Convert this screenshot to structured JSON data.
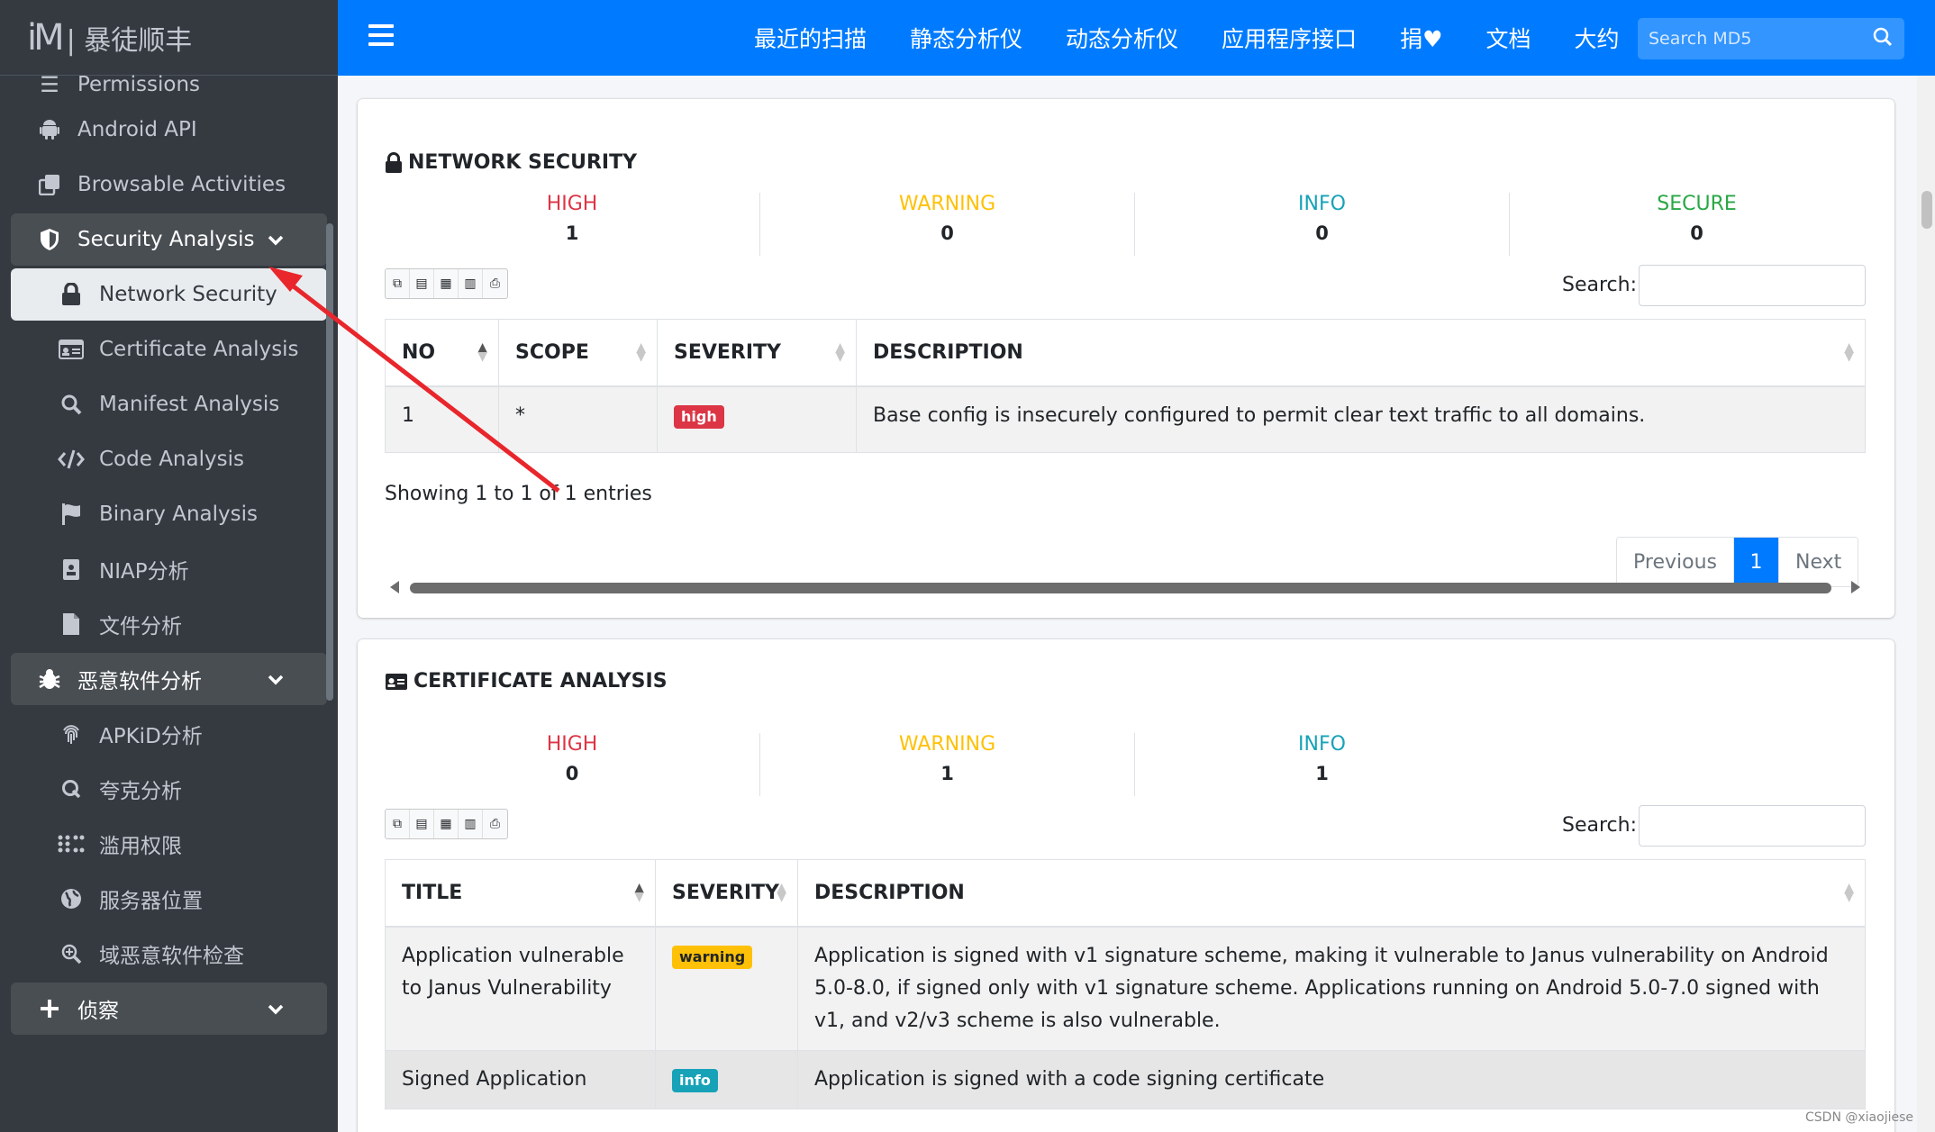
{
  "brand": {
    "logo": "iM",
    "name": "| 暴徒顺丰"
  },
  "sidebar": {
    "partial_label": "Permissions",
    "items": [
      {
        "label": "Android API",
        "icon": "android-icon"
      },
      {
        "label": "Browsable Activities",
        "icon": "clone-icon"
      },
      {
        "label": "Security Analysis",
        "icon": "shield-icon",
        "expanded": true
      },
      {
        "label": "Network Security",
        "icon": "lock-icon",
        "active": true
      },
      {
        "label": "Certificate Analysis",
        "icon": "id-card-icon"
      },
      {
        "label": "Manifest Analysis",
        "icon": "search-icon"
      },
      {
        "label": "Code Analysis",
        "icon": "code-icon"
      },
      {
        "label": "Binary Analysis",
        "icon": "flag-icon"
      },
      {
        "label": "NIAP分析",
        "icon": "clipboard-icon"
      },
      {
        "label": "文件分析",
        "icon": "file-icon"
      },
      {
        "label": "恶意软件分析",
        "icon": "bug-icon",
        "expanded": true
      },
      {
        "label": "APKiD分析",
        "icon": "fingerprint-icon"
      },
      {
        "label": "夸克分析",
        "icon": "quark-icon"
      },
      {
        "label": "滥用权限",
        "icon": "dots-grid-icon"
      },
      {
        "label": "服务器位置",
        "icon": "globe-icon"
      },
      {
        "label": "域恶意软件检查",
        "icon": "search-plus-icon"
      },
      {
        "label": "侦察",
        "icon": "plus-icon",
        "expanded": true
      }
    ]
  },
  "navbar": {
    "links": [
      "最近的扫描",
      "静态分析仪",
      "动态分析仪",
      "应用程序接口",
      "捐♥",
      "文档",
      "大约"
    ],
    "search_placeholder": "Search MD5"
  },
  "network_security": {
    "title": "NETWORK SECURITY",
    "stats": [
      {
        "label": "HIGH",
        "value": "1",
        "color": "#dc3545"
      },
      {
        "label": "WARNING",
        "value": "0",
        "color": "#ffc107"
      },
      {
        "label": "INFO",
        "value": "0",
        "color": "#17a2b8"
      },
      {
        "label": "SECURE",
        "value": "0",
        "color": "#28a745"
      }
    ],
    "search_label": "Search:",
    "columns": [
      "NO",
      "SCOPE",
      "SEVERITY",
      "DESCRIPTION"
    ],
    "rows": [
      {
        "no": "1",
        "scope": "*",
        "severity": "high",
        "description": "Base config is insecurely configured to permit clear text traffic to all domains."
      }
    ],
    "info": "Showing 1 to 1 of 1 entries",
    "pager": {
      "prev": "Previous",
      "page": "1",
      "next": "Next"
    }
  },
  "certificate_analysis": {
    "title": "CERTIFICATE ANALYSIS",
    "stats": [
      {
        "label": "HIGH",
        "value": "0",
        "color": "#dc3545"
      },
      {
        "label": "WARNING",
        "value": "1",
        "color": "#ffc107"
      },
      {
        "label": "INFO",
        "value": "1",
        "color": "#17a2b8"
      }
    ],
    "search_label": "Search:",
    "columns": [
      "TITLE",
      "SEVERITY",
      "DESCRIPTION"
    ],
    "rows": [
      {
        "title": "Application vulnerable to Janus Vulnerability",
        "severity": "warning",
        "description": "Application is signed with v1 signature scheme, making it vulnerable to Janus vulnerability on Android 5.0-8.0, if signed only with v1 signature scheme. Applications running on Android 5.0-7.0 signed with v1, and v2/v3 scheme is also vulnerable."
      },
      {
        "title": "Signed Application",
        "severity": "info",
        "description": "Application is signed with a code signing certificate"
      }
    ]
  },
  "watermark": "CSDN @xiaojiese"
}
